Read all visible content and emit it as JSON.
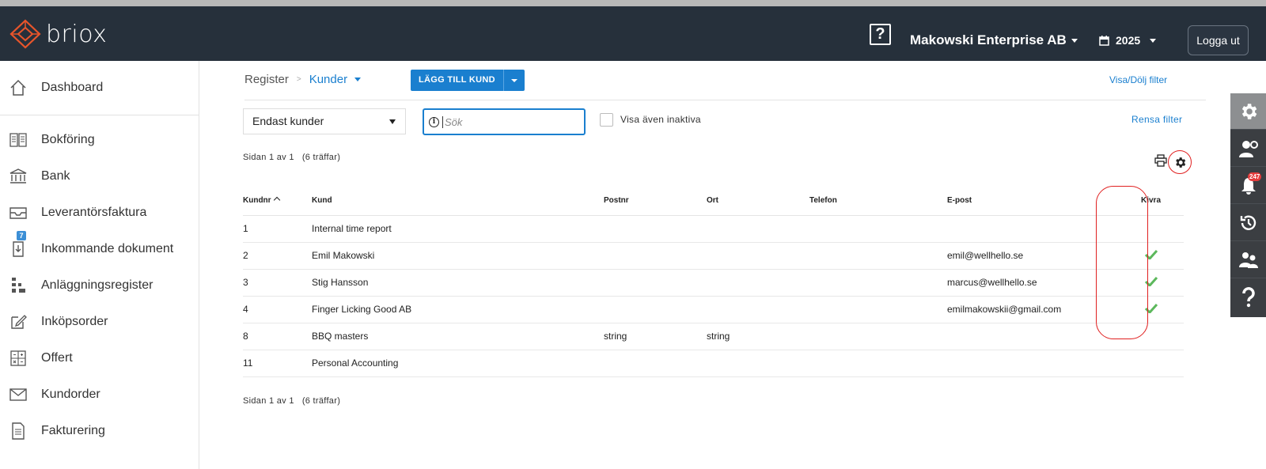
{
  "app": {
    "logo_text": "briox",
    "help_icon_label": "?",
    "company": "Makowski Enterprise AB",
    "year": "2025",
    "logout": "Logga ut"
  },
  "sidebar": {
    "items": [
      {
        "label": "Dashboard",
        "icon": "home-icon"
      },
      {
        "label": "Bokföring",
        "icon": "book-icon"
      },
      {
        "label": "Bank",
        "icon": "bank-icon"
      },
      {
        "label": "Leverantörsfaktura",
        "icon": "inbox-icon"
      },
      {
        "label": "Inkommande dokument",
        "icon": "document-inbox-icon",
        "badge": "7"
      },
      {
        "label": "Anläggningsregister",
        "icon": "assets-icon"
      },
      {
        "label": "Inköpsorder",
        "icon": "edit-icon"
      },
      {
        "label": "Offert",
        "icon": "calculator-icon"
      },
      {
        "label": "Kundorder",
        "icon": "envelope-icon"
      },
      {
        "label": "Fakturering",
        "icon": "invoice-icon"
      }
    ]
  },
  "header": {
    "breadcrumb_root": "Register",
    "breadcrumb_sep": ">",
    "breadcrumb_current": "Kunder",
    "add_button": "LÄGG TILL KUND",
    "toggle_filter": "Visa/Dölj filter"
  },
  "filters": {
    "select_value": "Endast kunder",
    "search_placeholder": "Sök",
    "show_inactive_label": "Visa även inaktiva",
    "clear_filter": "Rensa filter"
  },
  "pagination": {
    "top": "Sidan 1 av 1   (6 träffar)",
    "bottom": "Sidan 1 av 1   (6 träffar)"
  },
  "table": {
    "columns": [
      "Kundnr",
      "Kund",
      "Postnr",
      "Ort",
      "Telefon",
      "E-post",
      "Kivra"
    ],
    "rows": [
      {
        "nr": "1",
        "kund": "Internal time report",
        "postnr": "",
        "ort": "",
        "telefon": "",
        "epost": "",
        "kivra": false
      },
      {
        "nr": "2",
        "kund": "Emil Makowski",
        "postnr": "",
        "ort": "",
        "telefon": "",
        "epost": "emil@wellhello.se",
        "kivra": true
      },
      {
        "nr": "3",
        "kund": "Stig Hansson",
        "postnr": "",
        "ort": "",
        "telefon": "",
        "epost": "marcus@wellhello.se",
        "kivra": true
      },
      {
        "nr": "4",
        "kund": "Finger Licking Good AB",
        "postnr": "",
        "ort": "",
        "telefon": "",
        "epost": "emilmakowskii@gmail.com",
        "kivra": true
      },
      {
        "nr": "8",
        "kund": "BBQ masters",
        "postnr": "string",
        "ort": "string",
        "telefon": "",
        "epost": "",
        "kivra": false
      },
      {
        "nr": "11",
        "kund": "Personal Accounting",
        "postnr": "",
        "ort": "",
        "telefon": "",
        "epost": "",
        "kivra": false
      }
    ]
  },
  "right_toolbar": {
    "items": [
      "gear-icon",
      "users-settings-icon",
      "bell-icon",
      "history-icon",
      "people-icon",
      "question-icon"
    ],
    "notification_count": "247"
  },
  "colors": {
    "topbar": "#26303b",
    "accent": "#1a7fcf",
    "check": "#5cb85c",
    "annotation_red": "#e02020"
  }
}
